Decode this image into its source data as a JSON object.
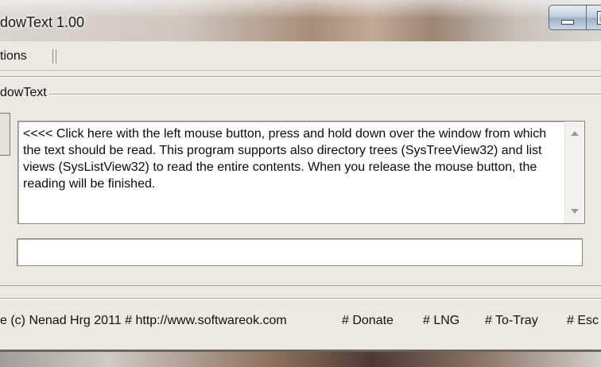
{
  "window": {
    "title": "dowText 1.00"
  },
  "menu": {
    "items": [
      "tions"
    ]
  },
  "group": {
    "label": "dowText"
  },
  "main": {
    "instructions": "<<<< Click here with the left mouse button, press and hold down over the window from which the text should be read. This program supports also directory trees (SysTreeView32) and list views (SysListView32) to read the entire contents. When you release the mouse button, the reading will be finished.",
    "output_value": ""
  },
  "footer": {
    "copyright": "e (c) Nenad Hrg 2011 # http://www.softwareok.com",
    "donate": "# Donate",
    "lng": "# LNG",
    "to_tray": "# To-Tray",
    "esc": "# Esc"
  },
  "icons": {
    "minimize": "minimize-icon",
    "maximize": "maximize-icon",
    "scroll_up": "scroll-up-icon",
    "scroll_down": "scroll-down-icon"
  },
  "colors": {
    "window_bg": "#ece9e2",
    "text": "#111111"
  }
}
